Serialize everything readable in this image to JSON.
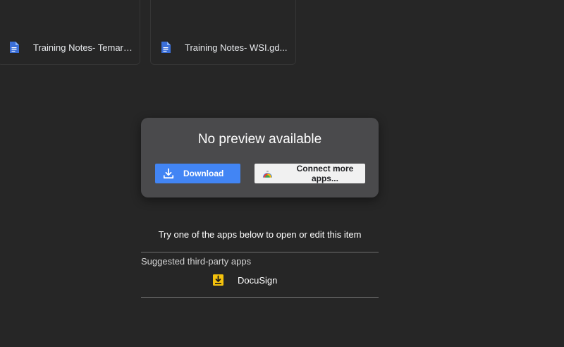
{
  "files": [
    {
      "name": "Training Notes- Temarr...",
      "icon": "docs-icon"
    },
    {
      "name": "Training Notes- WSI.gd...",
      "icon": "docs-icon"
    }
  ],
  "preview": {
    "title": "No preview available",
    "download_label": "Download",
    "connect_label": "Connect more apps..."
  },
  "suggest": {
    "prompt": "Try one of the apps below to open or edit this item",
    "heading": "Suggested third-party apps",
    "apps": [
      {
        "name": "DocuSign",
        "icon": "docusign-icon"
      }
    ]
  },
  "colors": {
    "background": "#262626",
    "panel": "#4a4a4c",
    "primary_button": "#4285f4",
    "doc_icon": "#3b6fd8",
    "docusign_yellow": "#f4c20d"
  }
}
